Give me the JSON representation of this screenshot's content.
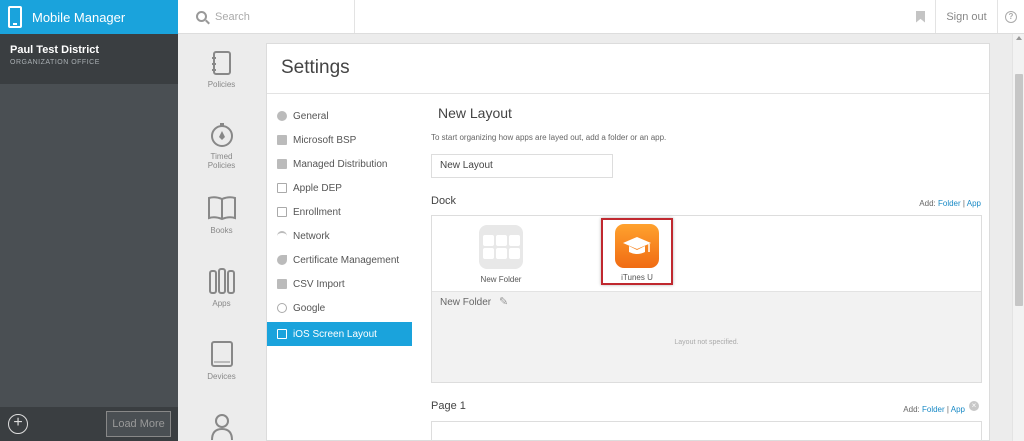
{
  "app": {
    "title": "Mobile Manager"
  },
  "org": {
    "name": "Paul Test District",
    "subtitle": "ORGANIZATION OFFICE"
  },
  "sidebar": {
    "load_more": "Load More"
  },
  "topbar": {
    "search_placeholder": "Search",
    "sign_out": "Sign out"
  },
  "iconnav": {
    "items": [
      {
        "label": "Policies",
        "icon": "notebook-icon"
      },
      {
        "label": "Timed Policies",
        "icon": "timer-icon"
      },
      {
        "label": "Books",
        "icon": "book-icon"
      },
      {
        "label": "Apps",
        "icon": "apps-icon"
      },
      {
        "label": "Devices",
        "icon": "tablet-icon"
      },
      {
        "label": "",
        "icon": "user-icon"
      }
    ]
  },
  "settings": {
    "title": "Settings",
    "nav": [
      {
        "label": "General",
        "icon": "gear-icon"
      },
      {
        "label": "Microsoft BSP",
        "icon": "windows-icon"
      },
      {
        "label": "Managed Distribution",
        "icon": "stack-icon"
      },
      {
        "label": "Apple DEP",
        "icon": "device-icon"
      },
      {
        "label": "Enrollment",
        "icon": "device-icon"
      },
      {
        "label": "Network",
        "icon": "wifi-icon"
      },
      {
        "label": "Certificate Management",
        "icon": "key-icon"
      },
      {
        "label": "CSV Import",
        "icon": "import-icon"
      },
      {
        "label": "Google",
        "icon": "google-icon"
      },
      {
        "label": "iOS Screen Layout",
        "icon": "device-icon",
        "active": true
      }
    ]
  },
  "layout": {
    "title": "New Layout",
    "description": "To start organizing how apps are layed out, add a folder or an app.",
    "name_value": "New Layout",
    "dock": {
      "label": "Dock",
      "add_label": "Add:",
      "add_folder": "Folder",
      "add_app": "App",
      "separator": "|",
      "apps": [
        {
          "label": "New Folder",
          "type": "folder"
        },
        {
          "label": "iTunes U",
          "type": "app",
          "highlighted": true
        }
      ],
      "folder_name": "New Folder",
      "folder_empty": "Layout not specified."
    },
    "page1": {
      "label": "Page 1",
      "add_label": "Add:",
      "add_folder": "Folder",
      "add_app": "App",
      "separator": "|"
    }
  },
  "colors": {
    "brand": "#1aa3dc",
    "highlight": "#c0282f",
    "link": "#1a8ac6"
  }
}
